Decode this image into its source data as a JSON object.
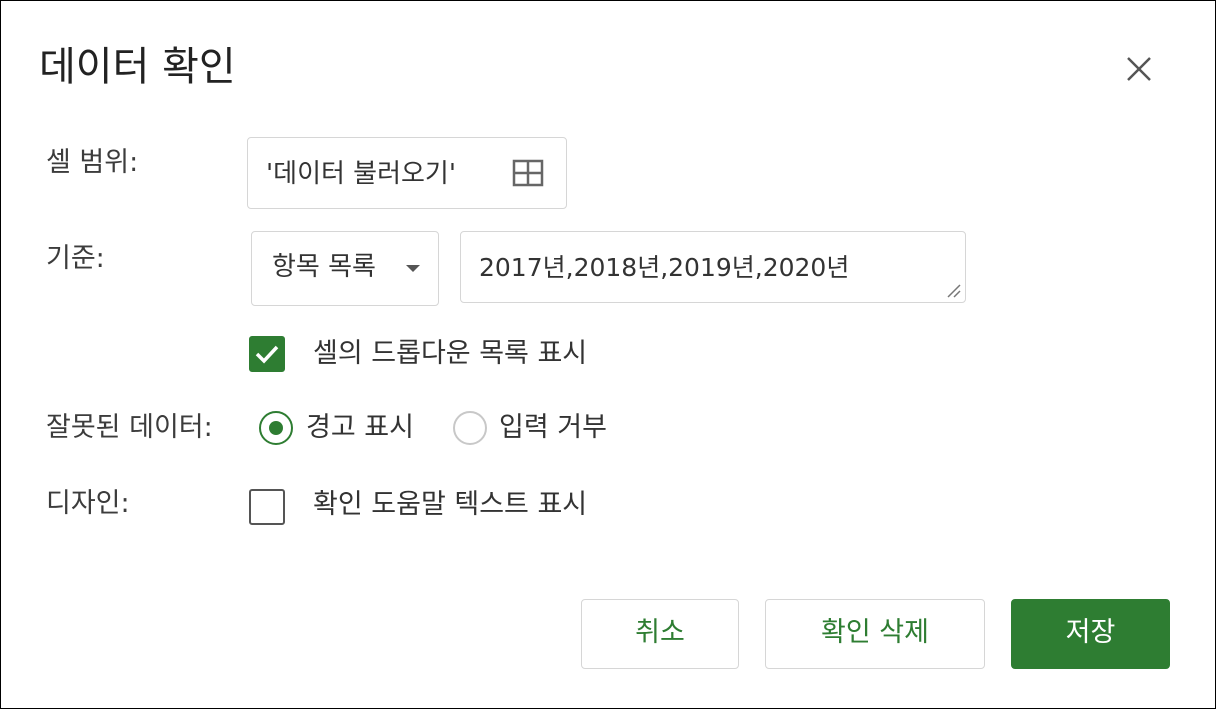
{
  "dialog": {
    "title": "데이터 확인",
    "close_icon": "close-icon"
  },
  "cell_range": {
    "label": "셀 범위:",
    "value": "'데이터 불러오기'",
    "icon": "grid-icon"
  },
  "criteria": {
    "label": "기준:",
    "type_selected": "항목 목록",
    "type_icon": "chevron-down-icon",
    "items_value": "2017년,2018년,2019년,2020년"
  },
  "dropdown_option": {
    "label": "셀의 드롭다운 목록 표시",
    "checked": true
  },
  "invalid_data": {
    "label": "잘못된 데이터:",
    "options": [
      {
        "label": "경고 표시",
        "selected": true
      },
      {
        "label": "입력 거부",
        "selected": false
      }
    ]
  },
  "appearance": {
    "label": "디자인:",
    "help_text_label": "확인 도움말 텍스트 표시",
    "checked": false
  },
  "buttons": {
    "cancel": "취소",
    "remove": "확인 삭제",
    "save": "저장"
  },
  "colors": {
    "accent": "#2e7d32",
    "border": "#d6d6d6",
    "text": "#333333"
  }
}
